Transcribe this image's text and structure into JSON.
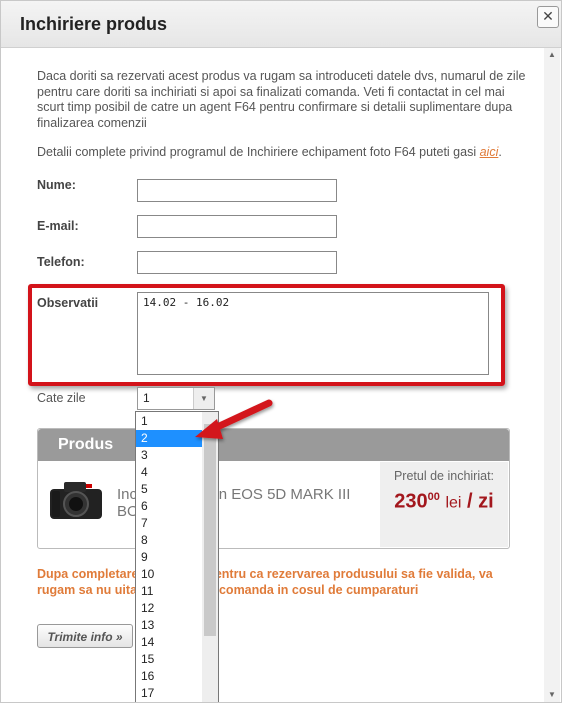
{
  "dialog": {
    "title": "Inchiriere produs",
    "close_label": "✕"
  },
  "form": {
    "intro": "Daca doriti sa rezervati acest produs va rugam sa introduceti datele dvs, numarul de zile pentru care doriti sa inchiriati si apoi sa finalizati comanda. Veti fi contactat in cel mai scurt timp posibil de catre un agent F64 pentru confirmare si detalii suplimentare dupa finalizarea comenzii",
    "details_text": "Detalii complete privind programul de Inchiriere echipament foto F64 puteti gasi ",
    "details_link": "aici",
    "details_end": ".",
    "name_label": "Nume:",
    "name_value": "",
    "email_label": "E-mail:",
    "email_value": "",
    "phone_label": "Telefon:",
    "phone_value": "",
    "notes_label": "Observatii",
    "notes_value": "14.02 - 16.02",
    "days_label": "Cate zile",
    "days_selected": "1",
    "days_options": [
      "1",
      "2",
      "3",
      "4",
      "5",
      "6",
      "7",
      "8",
      "9",
      "10",
      "11",
      "12",
      "13",
      "14",
      "15",
      "16",
      "17"
    ],
    "days_highlighted": "2"
  },
  "product": {
    "header": "Produs",
    "name": "Inchiriere Canon EOS 5D MARK III BODY",
    "price_label": "Pretul de inchiriat:",
    "price_int": "230",
    "price_dec": "00",
    "currency": "lei",
    "per_label": "/ zi"
  },
  "warning": "Dupa completarea detaliilor, pentru ca rezervarea produsului sa fie valida, va rugam sa nu uitati sa finalizati comanda in cosul de cumparaturi",
  "submit_label": "Trimite info »",
  "colors": {
    "highlight": "#d3131a",
    "accent": "#e07b39",
    "price": "#a3171d",
    "selected": "#1e90ff"
  }
}
